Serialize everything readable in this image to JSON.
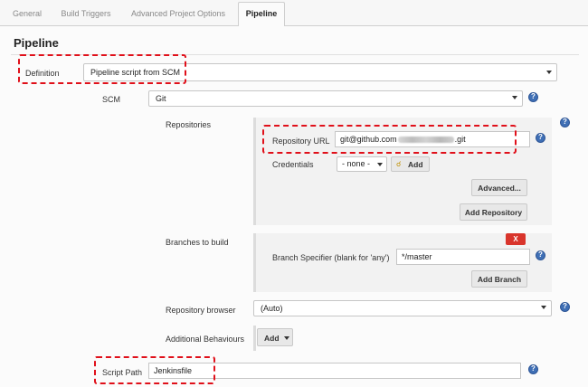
{
  "tabs": [
    {
      "label": "General"
    },
    {
      "label": "Build Triggers"
    },
    {
      "label": "Advanced Project Options"
    },
    {
      "label": "Pipeline",
      "active": true
    }
  ],
  "section_title": "Pipeline",
  "definition": {
    "label": "Definition",
    "value": "Pipeline script from SCM"
  },
  "scm": {
    "label": "SCM",
    "value": "Git"
  },
  "repositories": {
    "label": "Repositories",
    "repo_url_label": "Repository URL",
    "repo_url_prefix": "git@github.com",
    "repo_url_suffix": ".git",
    "credentials_label": "Credentials",
    "credentials_value": "- none -",
    "add_label": "Add",
    "advanced_label": "Advanced...",
    "add_repository_label": "Add Repository"
  },
  "branches": {
    "label": "Branches to build",
    "delete_label": "X",
    "specifier_label": "Branch Specifier (blank for 'any')",
    "specifier_value": "*/master",
    "add_branch_label": "Add Branch"
  },
  "repo_browser": {
    "label": "Repository browser",
    "value": "(Auto)"
  },
  "additional_behaviours": {
    "label": "Additional Behaviours",
    "add_label": "Add"
  },
  "script_path": {
    "label": "Script Path",
    "value": "Jenkinsfile"
  },
  "colors": {
    "highlight": "#e0101a",
    "help": "#3f6fb5",
    "delete": "#d9352c"
  },
  "icons": {
    "help": "help-icon",
    "key": "key-icon",
    "dropdown": "chevron-down-icon"
  }
}
